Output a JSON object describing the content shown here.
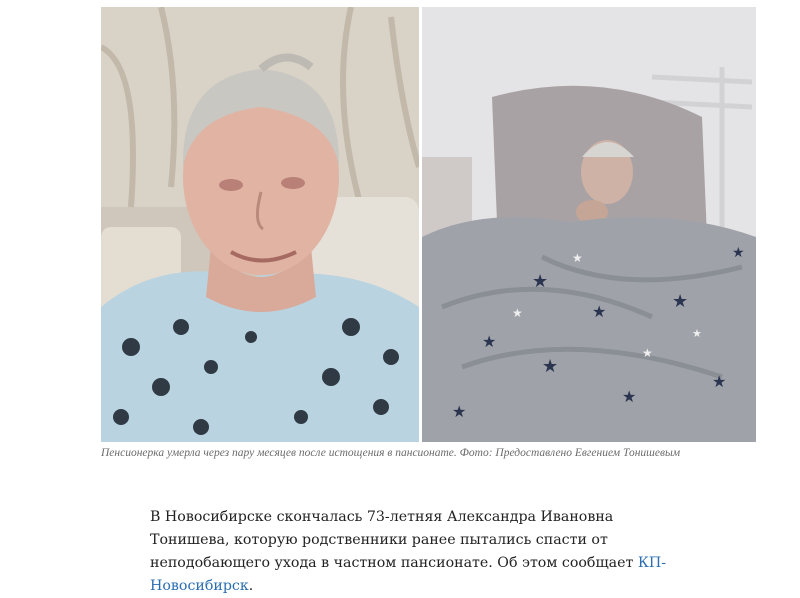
{
  "photo": {
    "left_subject": "photo-pensioner-before",
    "right_subject": "photo-pensioner-in-bed"
  },
  "caption": {
    "text": "Пенсионерка умерла через пару месяцев после истощения в пансионате. Фото: Предоставлено Евгением Тонишевым"
  },
  "article": {
    "text_before_link": "В Новосибирске скончалась 73-летняя Александра Ивановна Тонишева, которую родственники ранее пытались спасти от неподобающего ухода в частном пансионате. Об этом сообщает ",
    "link_text": "КП-Новосибирск",
    "text_after_link": "."
  },
  "colors": {
    "link": "#2a6db0",
    "caption": "#6b6b6b",
    "body_text": "#222222"
  }
}
